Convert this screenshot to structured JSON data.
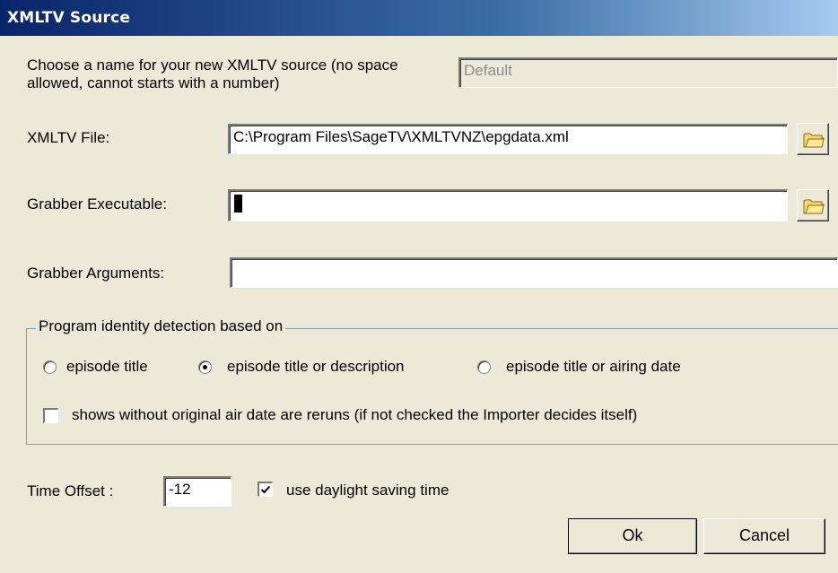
{
  "window": {
    "title": "XMLTV Source"
  },
  "source_name": {
    "label": "Choose a name for your new XMLTV source (no space allowed, cannot starts with a number)",
    "value": "Default"
  },
  "xmltv_file": {
    "label": "XMLTV File:",
    "value": "C:\\Program Files\\SageTV\\XMLTVNZ\\epgdata.xml",
    "browse_icon": "folder-icon"
  },
  "grabber_executable": {
    "label": "Grabber Executable:",
    "value": "",
    "browse_icon": "folder-icon"
  },
  "grabber_arguments": {
    "label": "Grabber Arguments:",
    "value": ""
  },
  "detection": {
    "legend": "Program identity detection based on",
    "options": [
      {
        "label": "episode title",
        "selected": false
      },
      {
        "label": "episode title or description",
        "selected": true
      },
      {
        "label": "episode title or airing date",
        "selected": false
      }
    ],
    "reruns_checkbox": {
      "label": "shows without original air date are reruns (if not checked the Importer decides itself)",
      "checked": false
    }
  },
  "time_offset": {
    "label": "Time Offset :",
    "value": "-12"
  },
  "daylight_saving": {
    "label": "use daylight saving time",
    "checked": true
  },
  "buttons": {
    "ok": "Ok",
    "cancel": "Cancel"
  },
  "colors": {
    "dialog_bg": "#ece9d8",
    "title_start": "#0a246a",
    "title_end": "#a6caf0"
  }
}
